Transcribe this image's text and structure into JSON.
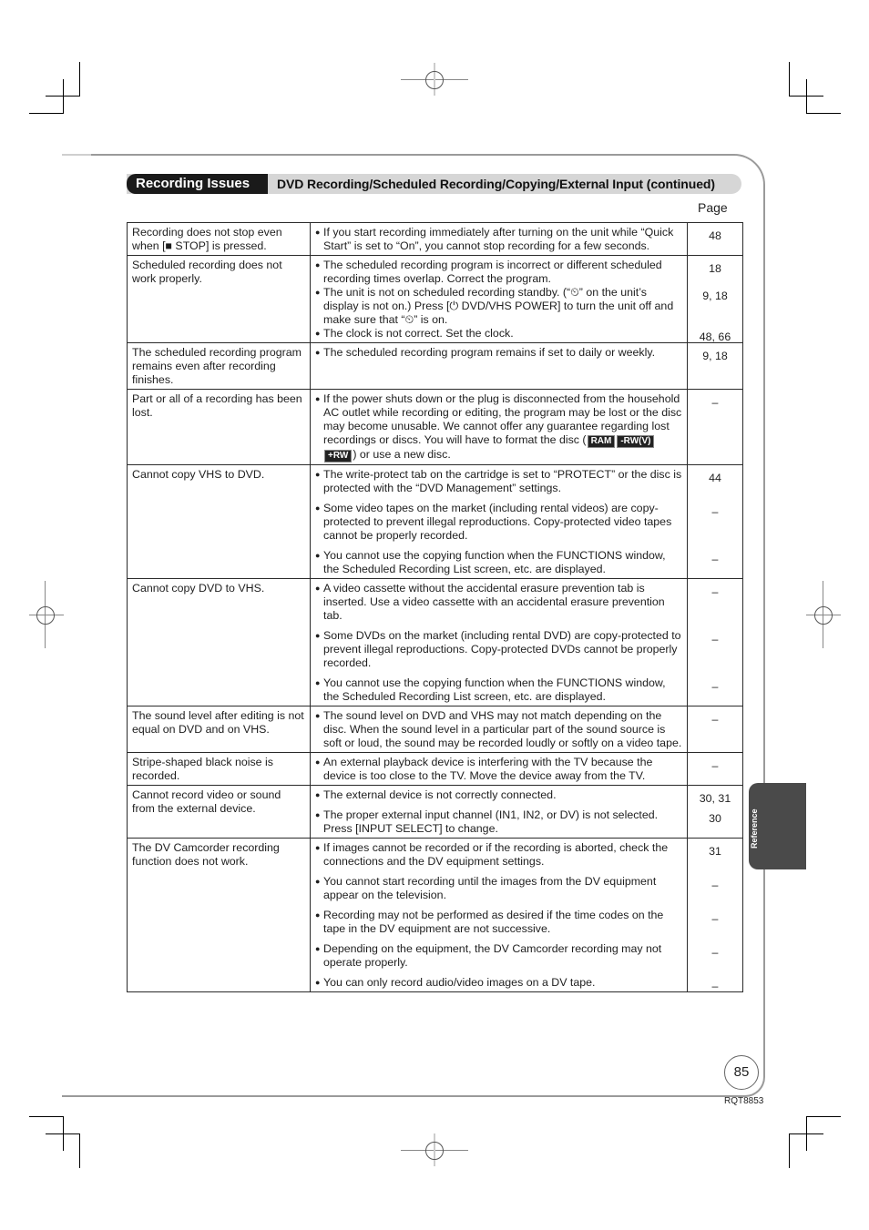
{
  "header": {
    "section": "Recording Issues",
    "subtitle": "DVD Recording/Scheduled Recording/Copying/External Input (continued)",
    "page_column_label": "Page"
  },
  "rows": [
    {
      "problem": "Recording does not stop even when [■ STOP] is pressed.",
      "causes": [
        {
          "text": "If you start recording immediately after turning on the unit while “Quick Start” is set to “On”, you cannot stop recording for a few seconds.",
          "page": "48"
        }
      ]
    },
    {
      "problem": "Scheduled recording does not work properly.",
      "causes": [
        {
          "text": "The scheduled recording program is incorrect or different scheduled recording times overlap. Correct the program.",
          "page": "18"
        },
        {
          "text": "The unit is not on scheduled recording standby. (“⏲” on the unit’s display is not on.) Press [⏻ DVD/VHS POWER] to turn the unit off and make sure that “⏲” is on.",
          "page": "9, 18"
        },
        {
          "text": "The clock is not correct. Set the clock.",
          "page": "48, 66"
        }
      ]
    },
    {
      "problem": "The scheduled recording program remains even after recording finishes.",
      "causes": [
        {
          "text": "The scheduled recording program remains if set to daily or weekly.",
          "page": "9, 18"
        }
      ]
    },
    {
      "problem": "Part or all of a recording has been lost.",
      "causes": [
        {
          "text": "If the power shuts down or the plug is disconnected from the household AC outlet while recording or editing, the program may be lost or the disc may become unusable. We cannot offer any guarantee regarding lost recordings or discs. You will have to format the disc (",
          "text_after": ") or use a new disc.",
          "badges": [
            "RAM",
            "-RW(V)",
            "+RW"
          ],
          "page": "–"
        }
      ]
    },
    {
      "problem": "Cannot copy VHS to DVD.",
      "causes": [
        {
          "text": "The write-protect tab on the cartridge is set to “PROTECT” or the disc is protected with the “DVD Management” settings.",
          "page": "44"
        },
        {
          "text": "Some video tapes on the market (including rental videos) are copy-protected to prevent illegal reproductions. Copy-protected video tapes cannot be properly recorded.",
          "page": "–"
        },
        {
          "text": "You cannot use the copying function when the FUNCTIONS window, the Scheduled Recording List screen, etc. are displayed.",
          "page": "–"
        }
      ]
    },
    {
      "problem": "Cannot copy DVD to VHS.",
      "causes": [
        {
          "text": "A video cassette without the accidental erasure prevention tab is inserted. Use a video cassette with an accidental erasure prevention tab.",
          "page": "–"
        },
        {
          "text": "Some DVDs on the market (including rental DVD) are copy-protected to prevent illegal reproductions. Copy-protected DVDs cannot be properly recorded.",
          "page": "–"
        },
        {
          "text": "You cannot use the copying function when the FUNCTIONS window, the Scheduled Recording List screen, etc. are displayed.",
          "page": "–"
        }
      ]
    },
    {
      "problem": "The sound level after editing is not equal on DVD and on VHS.",
      "causes": [
        {
          "text": "The sound level on DVD and VHS may not match depending on the disc. When the sound level in a particular part of the sound source is soft or loud, the sound may be recorded loudly or softly on a video tape.",
          "page": "–"
        }
      ]
    },
    {
      "problem": "Stripe-shaped black noise is recorded.",
      "causes": [
        {
          "text": "An external playback device is interfering with the TV because the device is too close to the TV. Move the device away from the TV.",
          "page": "–"
        }
      ]
    },
    {
      "problem": "Cannot record video or sound from the external device.",
      "causes": [
        {
          "text": "The external device is not correctly connected.",
          "page": "30, 31"
        },
        {
          "text": "The proper external input channel (IN1, IN2, or DV) is not selected. Press [INPUT SELECT] to change.",
          "page": "30"
        }
      ]
    },
    {
      "problem": "The DV Camcorder recording function does not work.",
      "causes": [
        {
          "text": "If images cannot be recorded or if the recording is aborted, check the connections and the DV equipment settings.",
          "page": "31"
        },
        {
          "text": "You cannot start recording until the images from the DV equipment appear on the television.",
          "page": "–"
        },
        {
          "text": "Recording may not be performed as desired if the time codes on the tape in the DV equipment are not successive.",
          "page": "–"
        },
        {
          "text": "Depending on the equipment, the DV Camcorder recording may not operate properly.",
          "page": "–"
        },
        {
          "text": "You can only record audio/video images on a DV tape.",
          "page": "–"
        }
      ]
    }
  ],
  "side_tab": {
    "label": "Reference"
  },
  "footer": {
    "page_number": "85",
    "model_code": "RQT8853"
  }
}
